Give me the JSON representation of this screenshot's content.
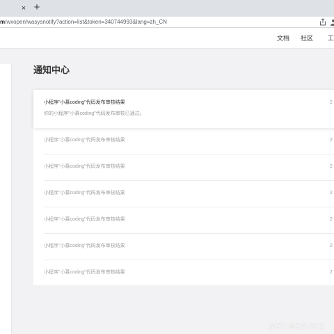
{
  "browser": {
    "close_glyph": "×",
    "new_tab_glyph": "+",
    "url_host": "m",
    "url_rest": "/wxopen/wasysnotify?action=list&token=340744993&lang=zh_CN",
    "icons": [
      "close-icon",
      "plus-icon",
      "share-icon",
      "profile-icon"
    ]
  },
  "nav": {
    "docs": "文档",
    "community": "社区",
    "tools": "工"
  },
  "page": {
    "title": "通知中心"
  },
  "notices": [
    {
      "title": "小程序\"小慕coding\"代码发布审核结果",
      "date": "2",
      "desc": "你的小程序\"小慕coding\"代码发布审核已通过。",
      "expanded": true
    },
    {
      "title": "小程序\"小慕coding\"代码发布审核结果",
      "date": "2"
    },
    {
      "title": "小程序\"小慕coding\"代码发布审核结果",
      "date": "2"
    },
    {
      "title": "小程序\"小慕coding\"代码发布审核结果",
      "date": "2"
    },
    {
      "title": "小程序\"小慕coding\"代码发布审核结果",
      "date": "2"
    },
    {
      "title": "小程序\"小慕coding\"代码发布审核结果",
      "date": "2"
    },
    {
      "title": "小程序\"小慕coding\"代码发布审核结果",
      "date": "2"
    }
  ],
  "watermark": "@稀土掘金技术社区",
  "colors": {
    "page_bg": "#f2f2f4",
    "text_primary": "#353535",
    "text_muted": "#a3a3a3"
  }
}
